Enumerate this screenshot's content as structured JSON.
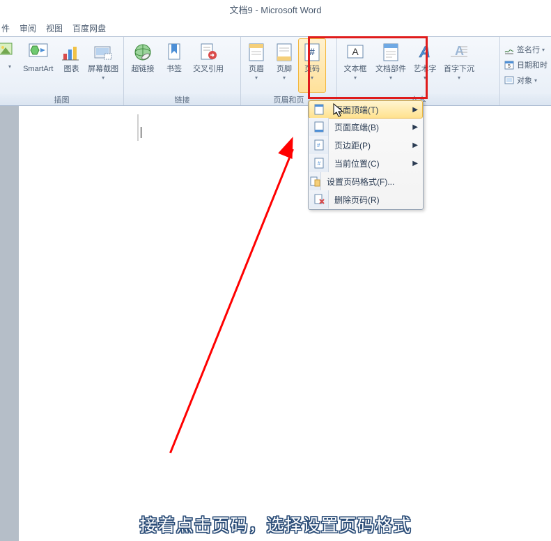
{
  "window": {
    "title": "文档9 - Microsoft Word"
  },
  "tabs": {
    "t0": "件",
    "t1": "审阅",
    "t2": "视图",
    "t3": "百度网盘"
  },
  "ribbon": {
    "insert_group": "插图",
    "links_group": "链接",
    "headfoot_group": "页眉和页",
    "text_group": "文本",
    "smartart": "SmartArt",
    "chart": "图表",
    "screenshot": "屏幕截图",
    "hyperlink": "超链接",
    "bookmark": "书签",
    "crossref": "交叉引用",
    "header": "页眉",
    "footer": "页脚",
    "pageno": "页码",
    "textbox": "文本框",
    "quickparts": "文档部件",
    "wordart": "艺术字",
    "dropcap": "首字下沉",
    "sigline": "签名行",
    "datetime": "日期和时",
    "object": "对象"
  },
  "menu": {
    "top": "页面顶端(T)",
    "bottom": "页面底端(B)",
    "margins": "页边距(P)",
    "current": "当前位置(C)",
    "format": "设置页码格式(F)...",
    "remove": "删除页码(R)"
  },
  "caption": "接着点击页码，选择设置页码格式"
}
